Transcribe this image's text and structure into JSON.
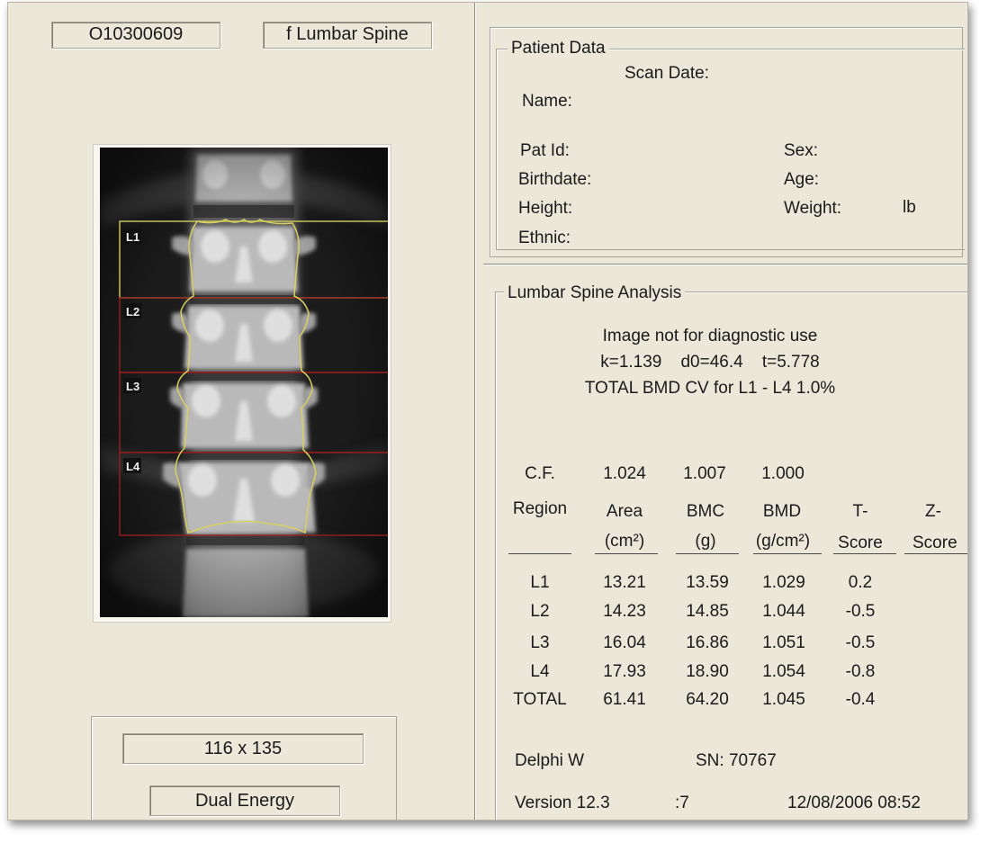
{
  "top_fields": {
    "scan_id": "O10300609",
    "scan_type": "f Lumbar Spine"
  },
  "image_labels": [
    "L1",
    "L2",
    "L3",
    "L4"
  ],
  "colors": {
    "panel": "#ebe8da",
    "roi_yellow": "#c8c25a",
    "roi_red": "#8e1e1e"
  },
  "bottom_fields": {
    "size": "116 x 135",
    "mode": "Dual Energy"
  },
  "patient": {
    "title": "Patient Data",
    "scan_date": "Scan Date:",
    "name": "Name:",
    "pat_id": "Pat Id:",
    "sex": "Sex:",
    "birthdate": "Birthdate:",
    "age": "Age:",
    "height": "Height:",
    "weight": "Weight:",
    "weight_unit": "lb",
    "ethnic": "Ethnic:"
  },
  "analysis": {
    "title": "Lumbar Spine Analysis",
    "line1": "Image not for diagnostic use",
    "line2": "k=1.139    d0=46.4    t=5.778",
    "line3": "TOTAL BMD CV for  L1 - L4  1.0%",
    "cf_label": "C.F.",
    "cf_values": [
      "1.024",
      "1.007",
      "1.000"
    ],
    "headers": [
      {
        "l1": "Region",
        "l2": ""
      },
      {
        "l1": "Area",
        "l2": "(cm²)"
      },
      {
        "l1": "BMC",
        "l2": "(g)"
      },
      {
        "l1": "BMD",
        "l2": "(g/cm²)"
      },
      {
        "l1": "T-",
        "l2": "Score"
      },
      {
        "l1": "Z-",
        "l2": "Score"
      }
    ],
    "rows": [
      {
        "region": "L1",
        "area": "13.21",
        "bmc": "13.59",
        "bmd": "1.029",
        "t": "0.2"
      },
      {
        "region": "L2",
        "area": "14.23",
        "bmc": "14.85",
        "bmd": "1.044",
        "t": "-0.5"
      },
      {
        "region": "L3",
        "area": "16.04",
        "bmc": "16.86",
        "bmd": "1.051",
        "t": "-0.5"
      },
      {
        "region": "L4",
        "area": "17.93",
        "bmc": "18.90",
        "bmd": "1.054",
        "t": "-0.8"
      },
      {
        "region": "TOTAL",
        "area": "61.41",
        "bmc": "64.20",
        "bmd": "1.045",
        "t": "-0.4"
      }
    ],
    "operator": "Delphi W",
    "sn": "SN: 70767",
    "version": "Version 12.3",
    "version_suffix": ":7",
    "datetime": "12/08/2006 08:52"
  }
}
